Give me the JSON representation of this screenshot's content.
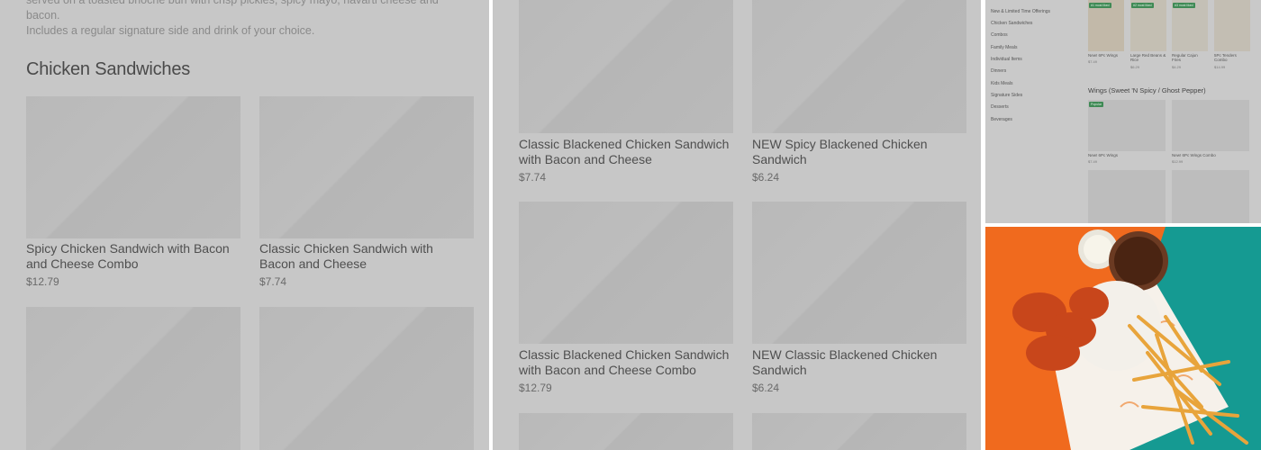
{
  "panel1": {
    "description_line1": "served on a toasted brioche bun with crisp pickles, spicy mayo, havarti cheese and bacon.",
    "description_line2": "Includes a regular signature side and drink of your choice.",
    "section_title": "Chicken Sandwiches",
    "items": [
      {
        "name_line1": "Spicy Chicken Sandwich with Bacon",
        "name_line2": "and Cheese Combo",
        "price": "$12.79"
      },
      {
        "name_line1": "Classic Chicken Sandwich with",
        "name_line2": "Bacon and Cheese",
        "price": "$7.74"
      }
    ]
  },
  "panel2": {
    "items": [
      {
        "name_line1": "Classic Blackened Chicken Sandwich",
        "name_line2": "with Bacon and Cheese",
        "price": "$7.74"
      },
      {
        "name_line1": "NEW Spicy Blackened Chicken",
        "name_line2": "Sandwich",
        "price": "$6.24"
      },
      {
        "name_line1": "Classic Blackened Chicken Sandwich",
        "name_line2": "with Bacon and Cheese Combo",
        "price": "$12.79"
      },
      {
        "name_line1": "NEW Classic Blackened Chicken",
        "name_line2": "Sandwich",
        "price": "$6.24"
      }
    ]
  },
  "panel3": {
    "nav": [
      "New & Limited Time Offerings",
      "Chicken Sandwiches",
      "Combos",
      "Family Meals",
      "Individual Items",
      "Dinners",
      "Kids Meals",
      "Signature Sides",
      "Desserts",
      "Beverages"
    ],
    "top_items": [
      {
        "badge": "#1 most liked",
        "name": "New! 6Pc Wings",
        "price": "$7.49"
      },
      {
        "badge": "#2 most liked",
        "name": "Large Red Beans & Rice",
        "price": "$6.29"
      },
      {
        "badge": "#3 most liked",
        "name": "Regular Cajun Fries",
        "price": "$4.29"
      },
      {
        "badge": "",
        "name": "5Pc Tenders Combo",
        "price": "$14.99"
      }
    ],
    "section_title": "Wings (Sweet 'N Spicy / Ghost Pepper)",
    "wing_badge": "Popular",
    "wing_items": [
      {
        "name": "New! 6Pc Wings",
        "price": "$7.49"
      },
      {
        "name": "New! 6Pc Wings Combo",
        "price": "$12.99"
      }
    ]
  },
  "colors": {
    "overlay_gray": "#c7c7c7",
    "badge_green": "#3f8a55",
    "photo_orange": "#f06a1e",
    "photo_teal": "#159a92"
  }
}
